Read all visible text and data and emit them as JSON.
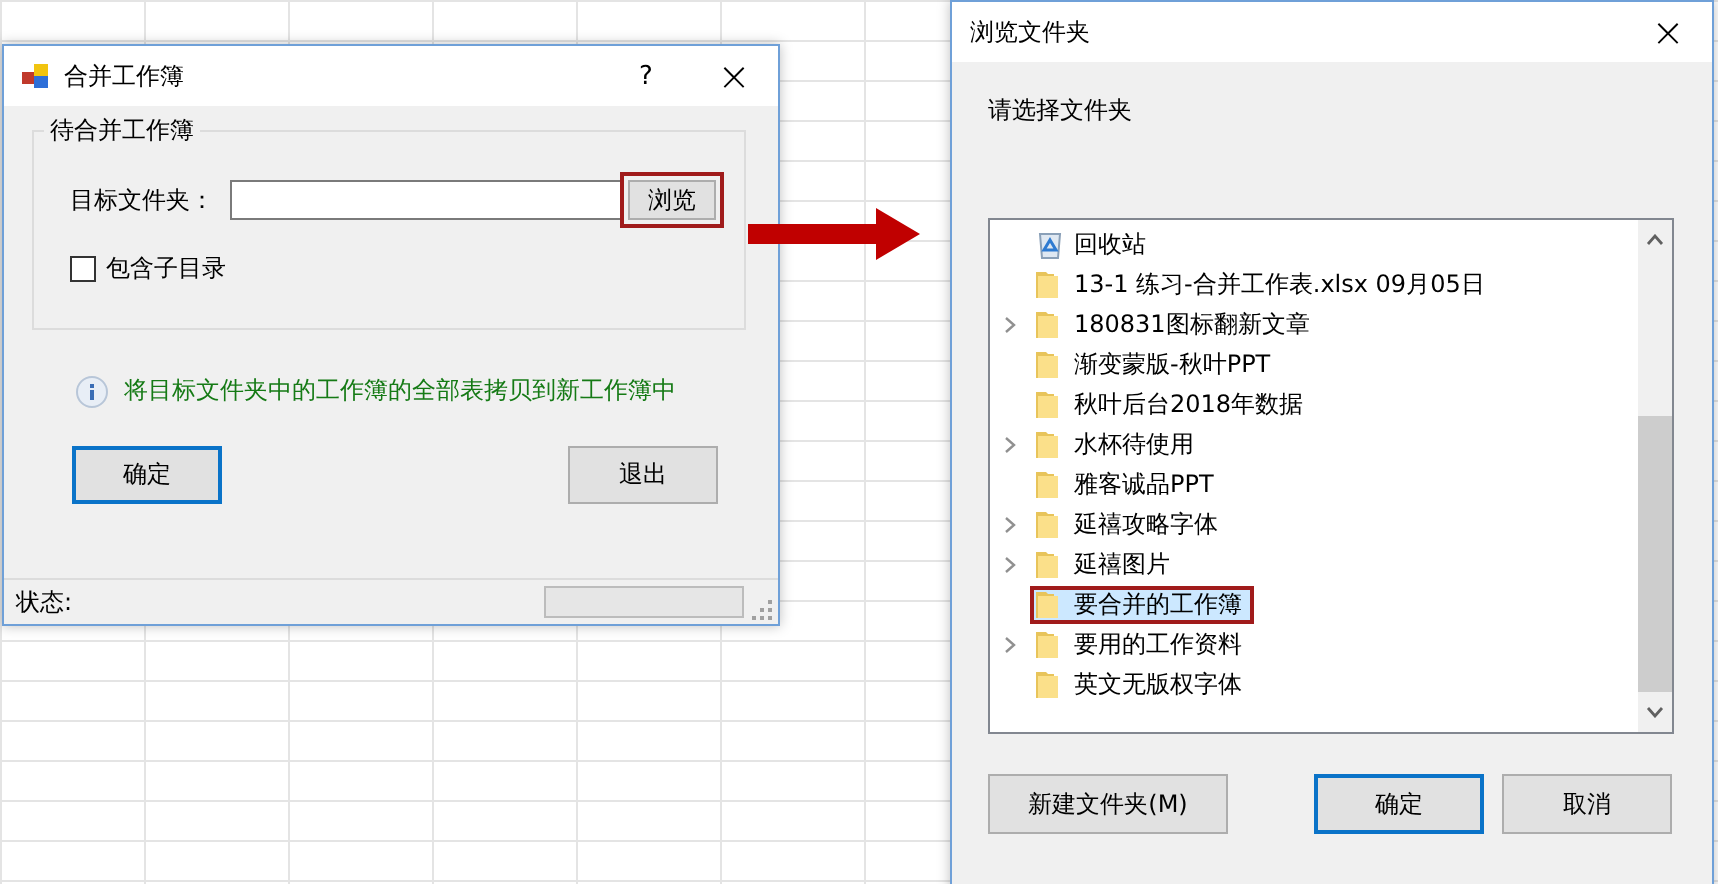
{
  "merge_dialog": {
    "title": "合并工作簿",
    "help": "?",
    "close": "×",
    "group": {
      "legend": "待合并工作簿",
      "folder_label": "目标文件夹：",
      "browse_button": {
        "label": "浏览",
        "callout": true
      },
      "include_subfolders": {
        "label": "包含子目录",
        "checked": false
      }
    },
    "info": "将目标文件夹中的工作簿的全部表拷贝到新工作簿中",
    "buttons": [
      {
        "label": "确定",
        "default": true
      },
      {
        "label": "退出",
        "default": false
      }
    ],
    "status_bar": {
      "label": "状态:"
    }
  },
  "browse_dialog": {
    "title": "浏览文件夹",
    "close": "×",
    "prompt": "请选择文件夹",
    "tree": [
      {
        "kind": "recycle",
        "label": "回收站",
        "expandable": false,
        "selected": false,
        "callout": false
      },
      {
        "kind": "folder",
        "label": "13-1 练习-合并工作表.xlsx 09月05日",
        "expandable": false,
        "selected": false,
        "callout": false
      },
      {
        "kind": "folder",
        "label": "180831图标翻新文章",
        "expandable": true,
        "selected": false,
        "callout": false
      },
      {
        "kind": "folder",
        "label": "渐变蒙版-秋叶PPT",
        "expandable": false,
        "selected": false,
        "callout": false
      },
      {
        "kind": "folder",
        "label": "秋叶后台2018年数据",
        "expandable": false,
        "selected": false,
        "callout": false
      },
      {
        "kind": "folder",
        "label": "水杯待使用",
        "expandable": true,
        "selected": false,
        "callout": false
      },
      {
        "kind": "folder",
        "label": "雅客诚品PPT",
        "expandable": false,
        "selected": false,
        "callout": false
      },
      {
        "kind": "folder",
        "label": "延禧攻略字体",
        "expandable": true,
        "selected": false,
        "callout": false
      },
      {
        "kind": "folder",
        "label": "延禧图片",
        "expandable": true,
        "selected": false,
        "callout": false
      },
      {
        "kind": "folder",
        "label": "要合并的工作簿",
        "expandable": false,
        "selected": true,
        "callout": true
      },
      {
        "kind": "folder",
        "label": "要用的工作资料",
        "expandable": true,
        "selected": false,
        "callout": false
      },
      {
        "kind": "folder",
        "label": "英文无版权字体",
        "expandable": false,
        "selected": false,
        "callout": false
      }
    ],
    "buttons": [
      {
        "label": "新建文件夹(M)",
        "default": false
      },
      {
        "label": "确定",
        "default": true
      },
      {
        "label": "取消",
        "default": false
      }
    ]
  }
}
